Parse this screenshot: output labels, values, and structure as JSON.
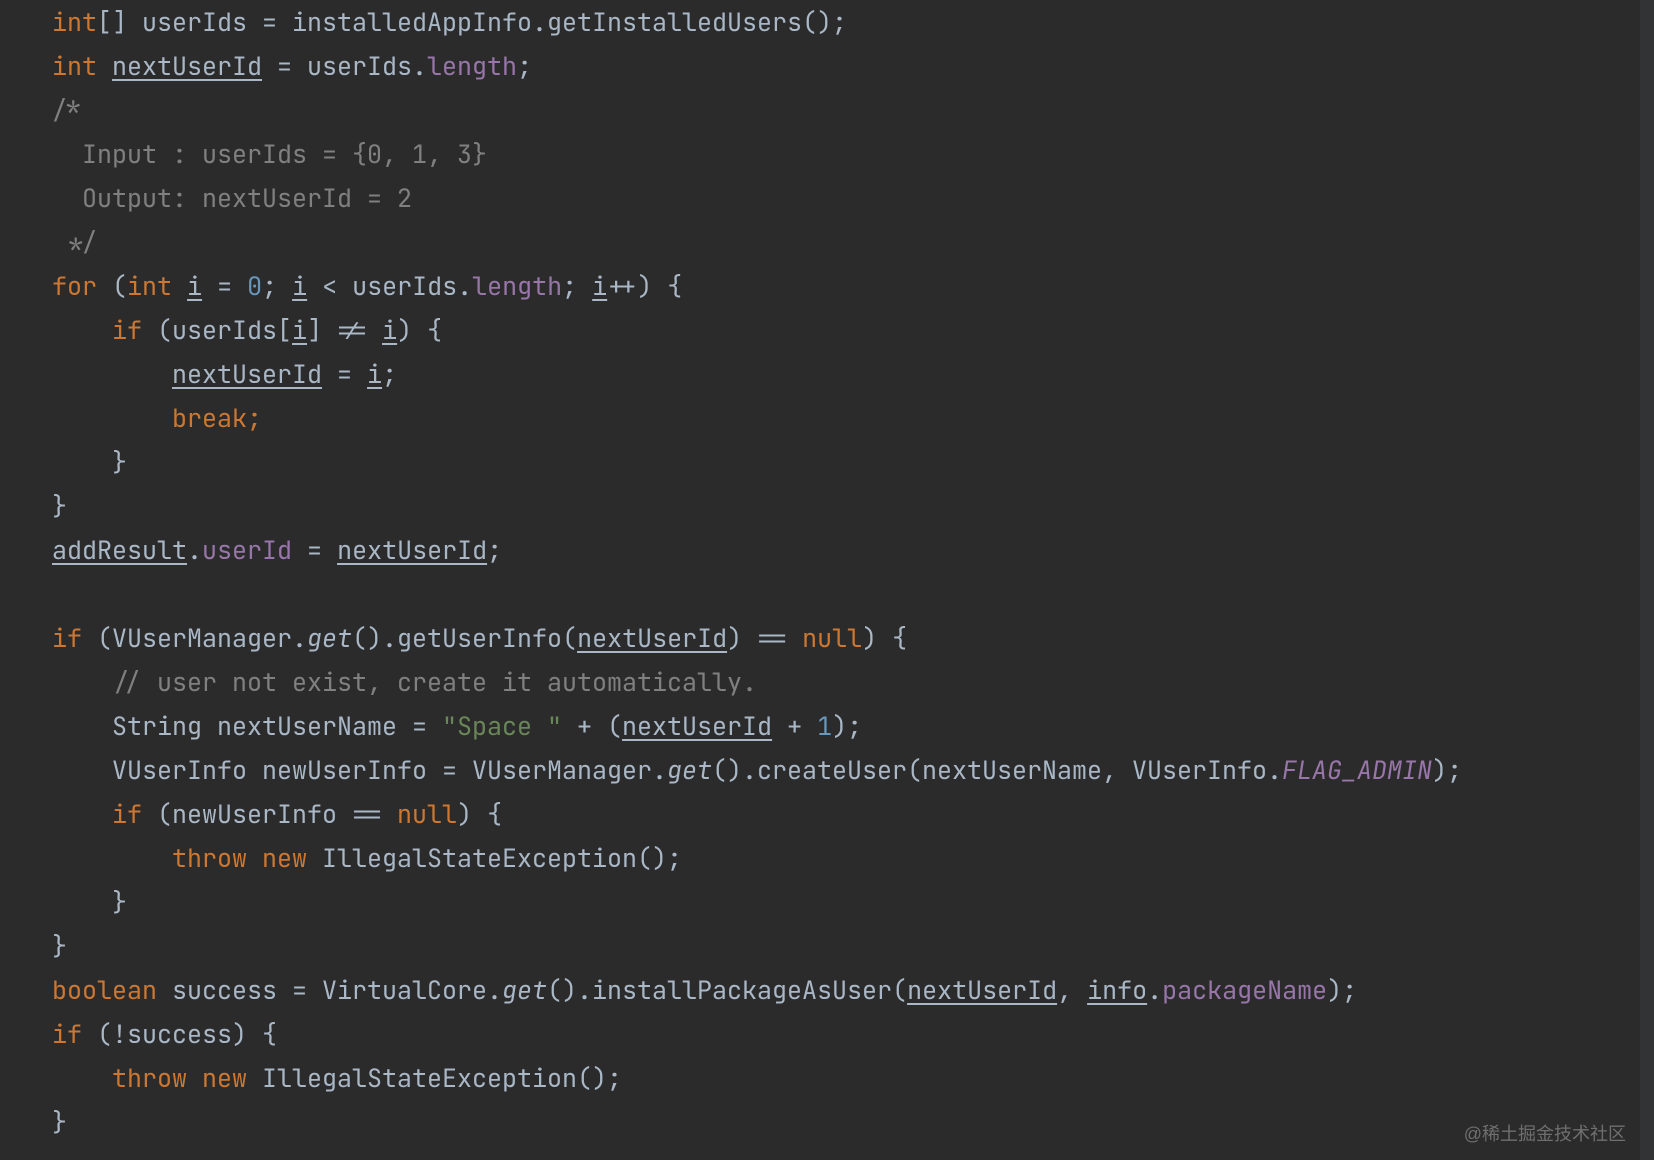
{
  "editor": {
    "watermark": "@稀土掘金技术社区",
    "tokens": {
      "l1": {
        "t1": "int",
        "t2": "[] userIds = installedAppInfo.getInstalledUsers();"
      },
      "l2": {
        "t1": "int ",
        "t2": "nextUserId",
        "t3": " = userIds.",
        "t4": "length",
        "t5": ";"
      },
      "l3": {
        "t1": "/*"
      },
      "l4": {
        "t1": "  Input : userIds = {0, 1, 3}"
      },
      "l5": {
        "t1": "  Output: nextUserId = 2"
      },
      "l6": {
        "t1": " */"
      },
      "l7": {
        "t1": "for ",
        "t2": "(",
        "t3": "int ",
        "t4": "i",
        "t5": " = ",
        "t6": "0",
        "t7": "; ",
        "t8": "i",
        "t9": " < userIds.",
        "t10": "length",
        "t11": "; ",
        "t12": "i",
        "t13": "++) {"
      },
      "l8": {
        "t1": "    if ",
        "t2": "(userIds[",
        "t3": "i",
        "t4": "] != ",
        "t5": "i",
        "t6": ") {"
      },
      "l9": {
        "t1": "        ",
        "t2": "nextUserId",
        "t3": " = ",
        "t4": "i",
        "t5": ";"
      },
      "l10": {
        "t1": "        ",
        "t2": "break;"
      },
      "l11": {
        "t1": "    }"
      },
      "l12": {
        "t1": "}"
      },
      "l13": {
        "t1": "addResult",
        "t2": ".",
        "t3": "userId",
        "t4": " = ",
        "t5": "nextUserId",
        "t6": ";"
      },
      "l14": {
        "t1": ""
      },
      "l15": {
        "t1": "if ",
        "t2": "(VUserManager.",
        "t3": "get",
        "t4": "().getUserInfo(",
        "t5": "nextUserId",
        "t6": ") == ",
        "t7": "null",
        "t8": ") {"
      },
      "l16": {
        "t1": "    ",
        "t2": "// user not exist, create it automatically."
      },
      "l17": {
        "t1": "    String nextUserName = ",
        "t2": "\"Space \"",
        "t3": " + (",
        "t4": "nextUserId",
        "t5": " + ",
        "t6": "1",
        "t7": ");"
      },
      "l18": {
        "t1": "    VUserInfo newUserInfo = VUserManager.",
        "t2": "get",
        "t3": "().createUser(nextUserName, VUserInfo.",
        "t4": "FLAG_ADMIN",
        "t5": ");"
      },
      "l19": {
        "t1": "    ",
        "t2": "if ",
        "t3": "(newUserInfo == ",
        "t4": "null",
        "t5": ") {"
      },
      "l20": {
        "t1": "        ",
        "t2": "throw new ",
        "t3": "IllegalStateException();"
      },
      "l21": {
        "t1": "    }"
      },
      "l22": {
        "t1": "}"
      },
      "l23": {
        "t1": "boolean ",
        "t2": "success = VirtualCore.",
        "t3": "get",
        "t4": "().installPackageAsUser(",
        "t5": "nextUserId",
        "t6": ", ",
        "t7": "info",
        "t8": ".",
        "t9": "packageName",
        "t10": ");"
      },
      "l24": {
        "t1": "if ",
        "t2": "(!success) {"
      },
      "l25": {
        "t1": "    ",
        "t2": "throw new ",
        "t3": "IllegalStateException();"
      },
      "l26": {
        "t1": "}"
      }
    }
  }
}
